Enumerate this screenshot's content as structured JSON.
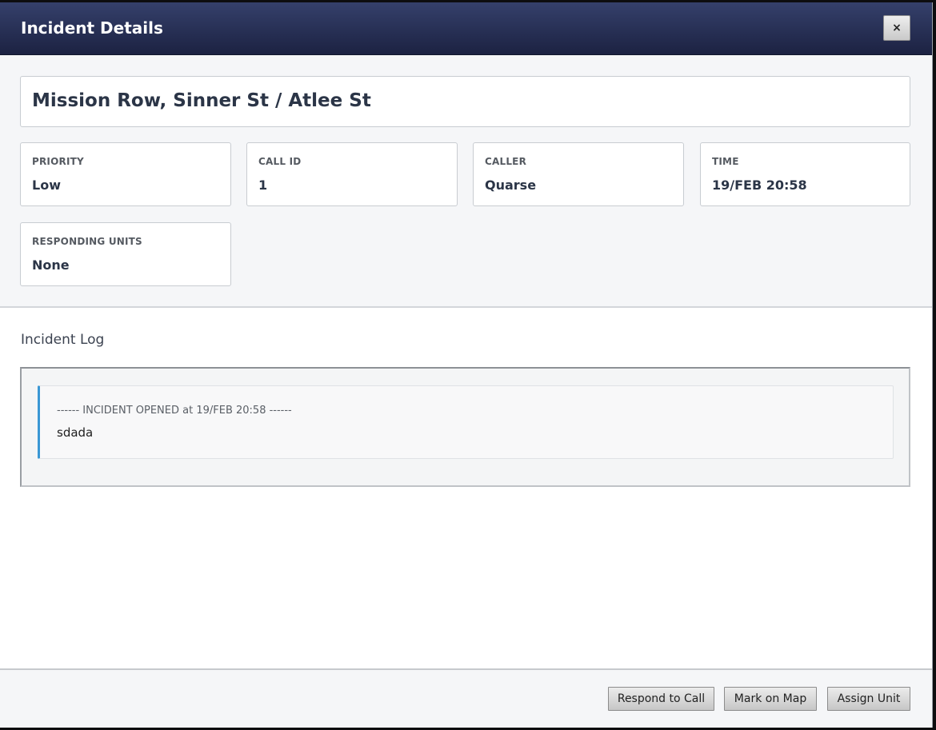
{
  "dialog": {
    "title": "Incident Details",
    "close_label": "×"
  },
  "incident": {
    "location": "Mission Row, Sinner St / Atlee St",
    "fields": [
      {
        "label": "PRIORITY",
        "value": "Low"
      },
      {
        "label": "CALL ID",
        "value": "1"
      },
      {
        "label": "CALLER",
        "value": "Quarse"
      },
      {
        "label": "TIME",
        "value": "19/FEB 20:58"
      },
      {
        "label": "RESPONDING UNITS",
        "value": "None"
      }
    ]
  },
  "log": {
    "title": "Incident Log",
    "entries": [
      {
        "header": "------ INCIDENT OPENED at 19/FEB 20:58 ------",
        "text": "sdada"
      }
    ]
  },
  "footer": {
    "respond_label": "Respond to Call",
    "mark_label": "Mark on Map",
    "assign_label": "Assign Unit"
  },
  "colors": {
    "header_bg": "#262d52",
    "log_accent": "#3a97d4"
  }
}
